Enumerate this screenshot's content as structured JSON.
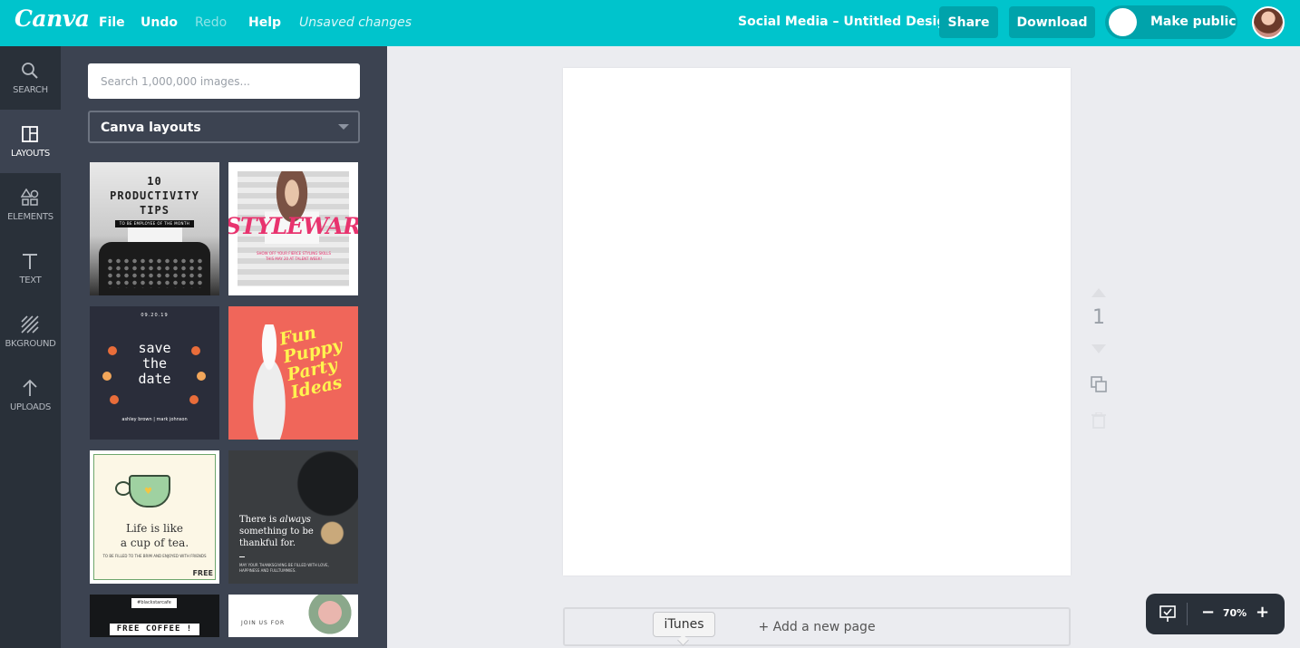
{
  "topbar": {
    "logo": "Canva",
    "menu": {
      "file": "File",
      "undo": "Undo",
      "redo": "Redo",
      "help": "Help"
    },
    "status": "Unsaved changes",
    "design_title": "Social Media – Untitled Design",
    "share": "Share",
    "download": "Download",
    "make_public": "Make public"
  },
  "sidebar": {
    "items": [
      {
        "label": "SEARCH",
        "icon": "search-icon"
      },
      {
        "label": "LAYOUTS",
        "icon": "layouts-icon",
        "active": true
      },
      {
        "label": "ELEMENTS",
        "icon": "shapes-icon"
      },
      {
        "label": "TEXT",
        "icon": "text-icon"
      },
      {
        "label": "BKGROUND",
        "icon": "background-icon"
      },
      {
        "label": "UPLOADS",
        "icon": "upload-icon"
      }
    ]
  },
  "panel": {
    "search_placeholder": "Search 1,000,000 images...",
    "dropdown_value": "Canva layouts",
    "layouts": {
      "productivity": {
        "title_lines": [
          "10",
          "PRODUCTIVITY",
          "TIPS"
        ],
        "bar": "TO BE EMPLOYEE OF THE MONTH"
      },
      "stylewars": {
        "word": "STYLEWARS",
        "small": "SHOW OFF YOUR FIERCE STYLING SKILLS THIS MAY 20 AT TALENT WEEK!"
      },
      "save_date": {
        "date": "09.20.19",
        "lines": [
          "save",
          "the",
          "date"
        ],
        "names": "ashley brown | mark johnson"
      },
      "puppy": {
        "lines": [
          "Fun",
          "Puppy",
          "Party",
          "Ideas"
        ]
      },
      "tea": {
        "line1": "Life is like",
        "line2": "a cup of tea.",
        "small": "TO BE FILLED TO THE BRIM AND ENJOYED WITH FRIENDS",
        "badge": "FREE"
      },
      "thankful": {
        "line1": "There is ",
        "line1_em": "always",
        "line2": "something to be",
        "line3": "thankful for.",
        "small": "MAY YOUR THANKSGIVING BE FILLED WITH LOVE, HAPPINESS AND FULLTUMMIES."
      },
      "coffee": {
        "tag": "#blackstarcafe",
        "label": "FREE COFFEE !"
      },
      "join": {
        "label": "JOIN US FOR"
      }
    }
  },
  "canvas": {
    "page_number": "1",
    "add_page": "+ Add a new page",
    "tooltip": "iTunes"
  },
  "zoom": {
    "value": "70%",
    "minus": "−",
    "plus": "+"
  },
  "colors": {
    "brand": "#00c4cc",
    "rail": "#293039",
    "panel": "#3c4351"
  }
}
